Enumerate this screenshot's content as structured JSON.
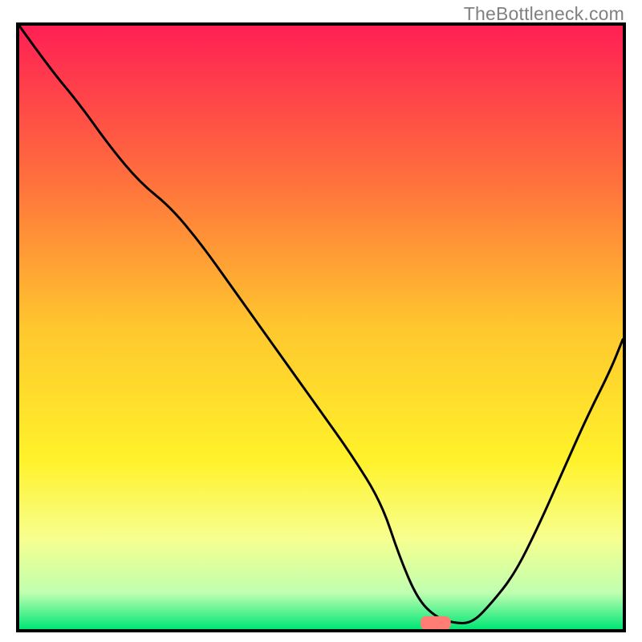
{
  "watermark": "TheBottleneck.com",
  "chart_data": {
    "type": "line",
    "title": "",
    "xlabel": "",
    "ylabel": "",
    "xlim": [
      0,
      100
    ],
    "ylim": [
      0,
      100
    ],
    "background": {
      "type": "vertical_gradient",
      "stops": [
        {
          "pos": 0.0,
          "color": "#ff1f54"
        },
        {
          "pos": 0.25,
          "color": "#ff6e3d"
        },
        {
          "pos": 0.5,
          "color": "#ffc72e"
        },
        {
          "pos": 0.72,
          "color": "#fff22a"
        },
        {
          "pos": 0.85,
          "color": "#f7ff8f"
        },
        {
          "pos": 0.94,
          "color": "#bfffb0"
        },
        {
          "pos": 1.0,
          "color": "#00e676"
        }
      ]
    },
    "series": [
      {
        "name": "curve",
        "x": [
          0,
          5,
          10,
          15,
          20,
          25,
          30,
          35,
          40,
          45,
          50,
          55,
          60,
          63,
          66,
          69,
          72,
          75,
          78,
          82,
          86,
          90,
          94,
          98,
          100
        ],
        "y": [
          100,
          93,
          87,
          80,
          74,
          70,
          64,
          57,
          50,
          43,
          36,
          29,
          21,
          12,
          5,
          2,
          1,
          1,
          4,
          9,
          17,
          26,
          35,
          43,
          48
        ]
      }
    ],
    "marker": {
      "shape": "rounded_rect",
      "x": 69,
      "y": 1,
      "width": 5,
      "height": 2.3,
      "color": "#ff7d75"
    }
  }
}
